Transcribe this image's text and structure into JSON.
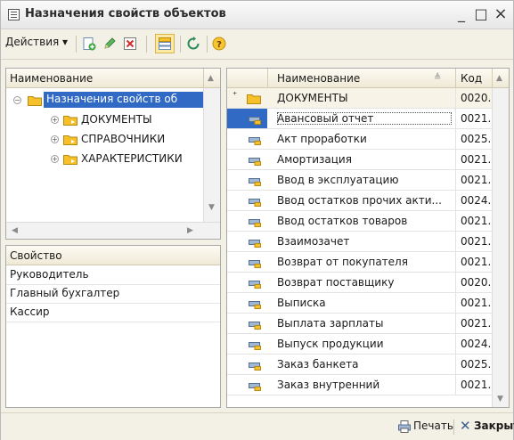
{
  "window": {
    "title": "Назначения свойств объектов",
    "min_glyph": "_",
    "max_glyph": "□",
    "close_glyph": "×"
  },
  "toolbar": {
    "actions_label": "Действия ▾"
  },
  "tree": {
    "header": "Наименование",
    "root_label": "Назначения свойств об",
    "items": [
      {
        "label": "ДОКУМЕНТЫ"
      },
      {
        "label": "СПРАВОЧНИКИ"
      },
      {
        "label": "ХАРАКТЕРИСТИКИ"
      }
    ]
  },
  "properties": {
    "header": "Свойство",
    "items": [
      {
        "label": "Руководитель"
      },
      {
        "label": "Главный бухгалтер"
      },
      {
        "label": "Кассир"
      }
    ]
  },
  "list": {
    "columns": {
      "name": "Наименование",
      "code": "Код"
    },
    "group_row": {
      "name": "ДОКУМЕНТЫ",
      "code": "0020..."
    },
    "rows": [
      {
        "name": "Авансовый отчет",
        "code": "0021..."
      },
      {
        "name": "Акт проработки",
        "code": "0025..."
      },
      {
        "name": "Амортизация",
        "code": "0021..."
      },
      {
        "name": "Ввод в эксплуатацию",
        "code": "0021..."
      },
      {
        "name": "Ввод остатков прочих акти...",
        "code": "0024..."
      },
      {
        "name": "Ввод остатков товаров",
        "code": "0021..."
      },
      {
        "name": "Взаимозачет",
        "code": "0021..."
      },
      {
        "name": "Возврат от покупателя",
        "code": "0021..."
      },
      {
        "name": "Возврат поставщику",
        "code": "0020..."
      },
      {
        "name": "Выписка",
        "code": "0021..."
      },
      {
        "name": "Выплата зарплаты",
        "code": "0021..."
      },
      {
        "name": "Выпуск продукции",
        "code": "0024..."
      },
      {
        "name": "Заказ банкета",
        "code": "0025..."
      },
      {
        "name": "Заказ внутренний",
        "code": "0021..."
      }
    ]
  },
  "footer": {
    "print_label": "Печать",
    "close_label": "Закрыть"
  },
  "colors": {
    "selection": "#316ac5",
    "group_row_bg": "#f7f3e6",
    "accent_folder": "#f5c02a"
  }
}
